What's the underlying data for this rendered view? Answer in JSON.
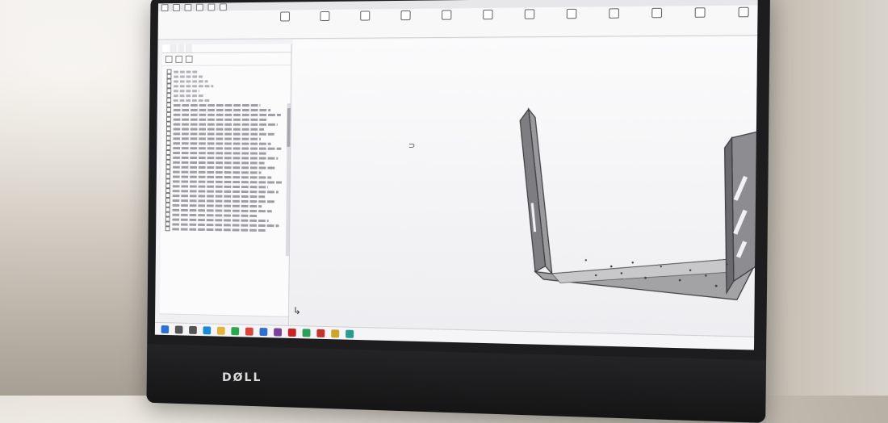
{
  "scene": {
    "brand": "DØLL",
    "colors": {
      "sheet_metal": "#8c8c8c",
      "sheet_metal_dark": "#3f3f42",
      "viewport_bg": "#f4f4f6",
      "bezel": "#1d1d1f"
    }
  },
  "cad_app": {
    "window_title": "",
    "panel_tabs": [
      "",
      "",
      "",
      ""
    ],
    "feature_tree_visible_rows": 34,
    "ribbon_icons": [
      "extrude-icon",
      "revolve-icon",
      "sweep-icon",
      "loft-icon",
      "fillet-icon",
      "pattern-icon",
      "rib-icon",
      "draft-icon",
      "shell-icon",
      "mirror-icon",
      "hole-icon",
      "sketch-icon",
      "dimension-icon",
      "smart-dimension-icon"
    ],
    "view_toolbar_icons": [
      "zoom-fit-icon",
      "zoom-area-icon",
      "previous-view-icon",
      "section-view-icon",
      "view-orientation-icon",
      "display-style-icon",
      "hide-show-icon",
      "appearance-icon",
      "scene-icon",
      "view-settings-icon"
    ],
    "taskbar_icons": [
      {
        "name": "start-icon",
        "color": "#2d6fd6"
      },
      {
        "name": "search-icon",
        "color": "#555555"
      },
      {
        "name": "task-view-icon",
        "color": "#555555"
      },
      {
        "name": "edge-icon",
        "color": "#1b8ad6"
      },
      {
        "name": "explorer-icon",
        "color": "#e4b33a"
      },
      {
        "name": "whatsapp-icon",
        "color": "#2aa84a"
      },
      {
        "name": "chrome-icon",
        "color": "#d9453a"
      },
      {
        "name": "app-blue-icon",
        "color": "#2f6fd0"
      },
      {
        "name": "app-purple-icon",
        "color": "#7a3fa0"
      },
      {
        "name": "acrobat-icon",
        "color": "#c22"
      },
      {
        "name": "app-green-icon",
        "color": "#2f9d5b"
      },
      {
        "name": "solidworks-icon",
        "color": "#c0352b"
      },
      {
        "name": "app-yellow-icon",
        "color": "#caa72a"
      },
      {
        "name": "app-teal-icon",
        "color": "#2a9c8a"
      }
    ]
  }
}
